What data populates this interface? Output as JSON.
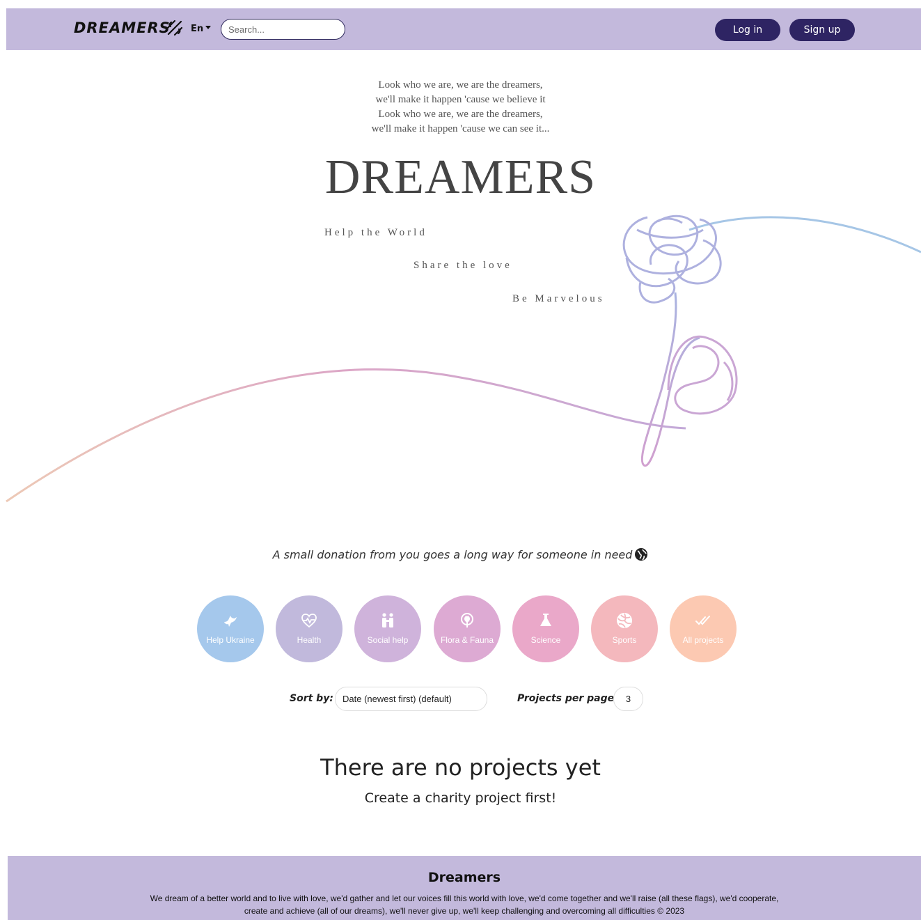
{
  "navbar": {
    "brand": "DREAMERS",
    "lang": "En",
    "search_placeholder": "Search...",
    "login_label": "Log in",
    "signup_label": "Sign up"
  },
  "hero": {
    "lyrics": [
      "Look who we are, we are the dreamers,",
      "we'll make it happen 'cause we believe it",
      "Look who we are, we are the dreamers,",
      "we'll make it happen 'cause we can see it..."
    ],
    "title": "DREAMERS",
    "taglines": [
      "Help the World",
      "Share the love",
      "Be Marvelous"
    ]
  },
  "motto": "A small donation from you goes a long way for someone in need",
  "categories": [
    {
      "label": "Help Ukraine",
      "icon": "dove-icon",
      "color": "#a5c8ec"
    },
    {
      "label": "Health",
      "icon": "heart-pulse-icon",
      "color": "#c1b9dc"
    },
    {
      "label": "Social help",
      "icon": "people-icon",
      "color": "#cfb3db"
    },
    {
      "label": "Flora & Fauna",
      "icon": "flower-icon",
      "color": "#ddaad3"
    },
    {
      "label": "Science",
      "icon": "flask-icon",
      "color": "#eaa8c9"
    },
    {
      "label": "Sports",
      "icon": "volleyball-icon",
      "color": "#f4b8bd"
    },
    {
      "label": "All projects",
      "icon": "double-check-icon",
      "color": "#fcc9b2"
    }
  ],
  "controls": {
    "sort_label": "Sort by:",
    "sort_value": "Date (newest first) (default)",
    "per_page_label": "Projects per page:",
    "per_page_value": "3"
  },
  "empty": {
    "title": "There are no projects yet",
    "subtitle": "Create a charity project first!"
  },
  "footer": {
    "title": "Dreamers",
    "text": "We dream of a better world and to live with love, we'd gather and let our voices fill this world with love, we'd come together and we'll raise (all these flags), we'd cooperate, create and achieve (all of our dreams), we'll never give up, we'll keep challenging and overcoming all difficulties © 2023"
  }
}
